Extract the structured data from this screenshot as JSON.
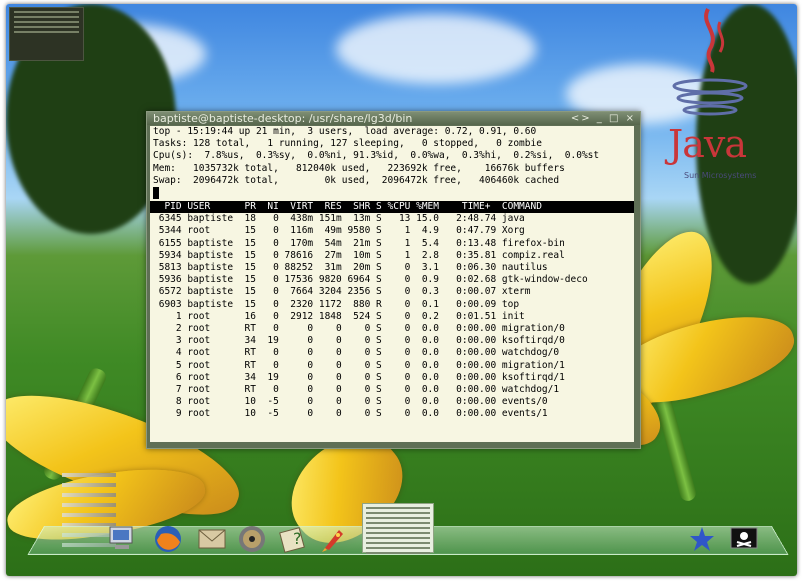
{
  "terminal": {
    "title": "baptiste@baptiste-desktop: /usr/share/lg3d/bin",
    "buttons": "<> _ □ ×",
    "summary": [
      "top - 15:19:44 up 21 min,  3 users,  load average: 0.72, 0.91, 0.60",
      "Tasks: 128 total,   1 running, 127 sleeping,   0 stopped,   0 zombie",
      "Cpu(s):  7.8%us,  0.3%sy,  0.0%ni, 91.3%id,  0.0%wa,  0.3%hi,  0.2%si,  0.0%st",
      "Mem:   1035732k total,   812040k used,   223692k free,    16676k buffers",
      "Swap:  2096472k total,        0k used,  2096472k free,   406460k cached"
    ],
    "header": "  PID USER      PR  NI  VIRT  RES  SHR S %CPU %MEM    TIME+  COMMAND",
    "processes": [
      " 6345 baptiste  18   0  438m 151m  13m S   13 15.0   2:48.74 java",
      " 5344 root      15   0  116m  49m 9580 S    1  4.9   0:47.79 Xorg",
      " 6155 baptiste  15   0  170m  54m  21m S    1  5.4   0:13.48 firefox-bin",
      " 5934 baptiste  15   0 78616  27m  10m S    1  2.8   0:35.81 compiz.real",
      " 5813 baptiste  15   0 88252  31m  20m S    0  3.1   0:06.30 nautilus",
      " 5936 baptiste  15   0 17536 9820 6964 S    0  0.9   0:02.68 gtk-window-deco",
      " 6572 baptiste  15   0  7664 3204 2356 S    0  0.3   0:00.07 xterm",
      " 6903 baptiste  15   0  2320 1172  880 R    0  0.1   0:00.09 top",
      "    1 root      16   0  2912 1848  524 S    0  0.2   0:01.51 init",
      "    2 root      RT   0     0    0    0 S    0  0.0   0:00.00 migration/0",
      "    3 root      34  19     0    0    0 S    0  0.0   0:00.00 ksoftirqd/0",
      "    4 root      RT   0     0    0    0 S    0  0.0   0:00.00 watchdog/0",
      "    5 root      RT   0     0    0    0 S    0  0.0   0:00.00 migration/1",
      "    6 root      34  19     0    0    0 S    0  0.0   0:00.00 ksoftirqd/1",
      "    7 root      RT   0     0    0    0 S    0  0.0   0:00.00 watchdog/1",
      "    8 root      10  -5     0    0    0 S    0  0.0   0:00.00 events/0",
      "    9 root      10  -5     0    0    0 S    0  0.0   0:00.00 events/1"
    ]
  },
  "java_logo": {
    "word": "Java",
    "tagline": "Sun Microsystems"
  },
  "dock": {
    "icons": [
      "computer-icon",
      "firefox-icon",
      "mail-icon",
      "cd-icon",
      "help-icon",
      "rocket-icon"
    ],
    "tray_icons": [
      "star-icon",
      "pirate-flag-icon"
    ]
  },
  "colors": {
    "terminal_bg": "#f7f6e2",
    "header_bg": "#000000",
    "window_frame": "#5f6f55"
  }
}
